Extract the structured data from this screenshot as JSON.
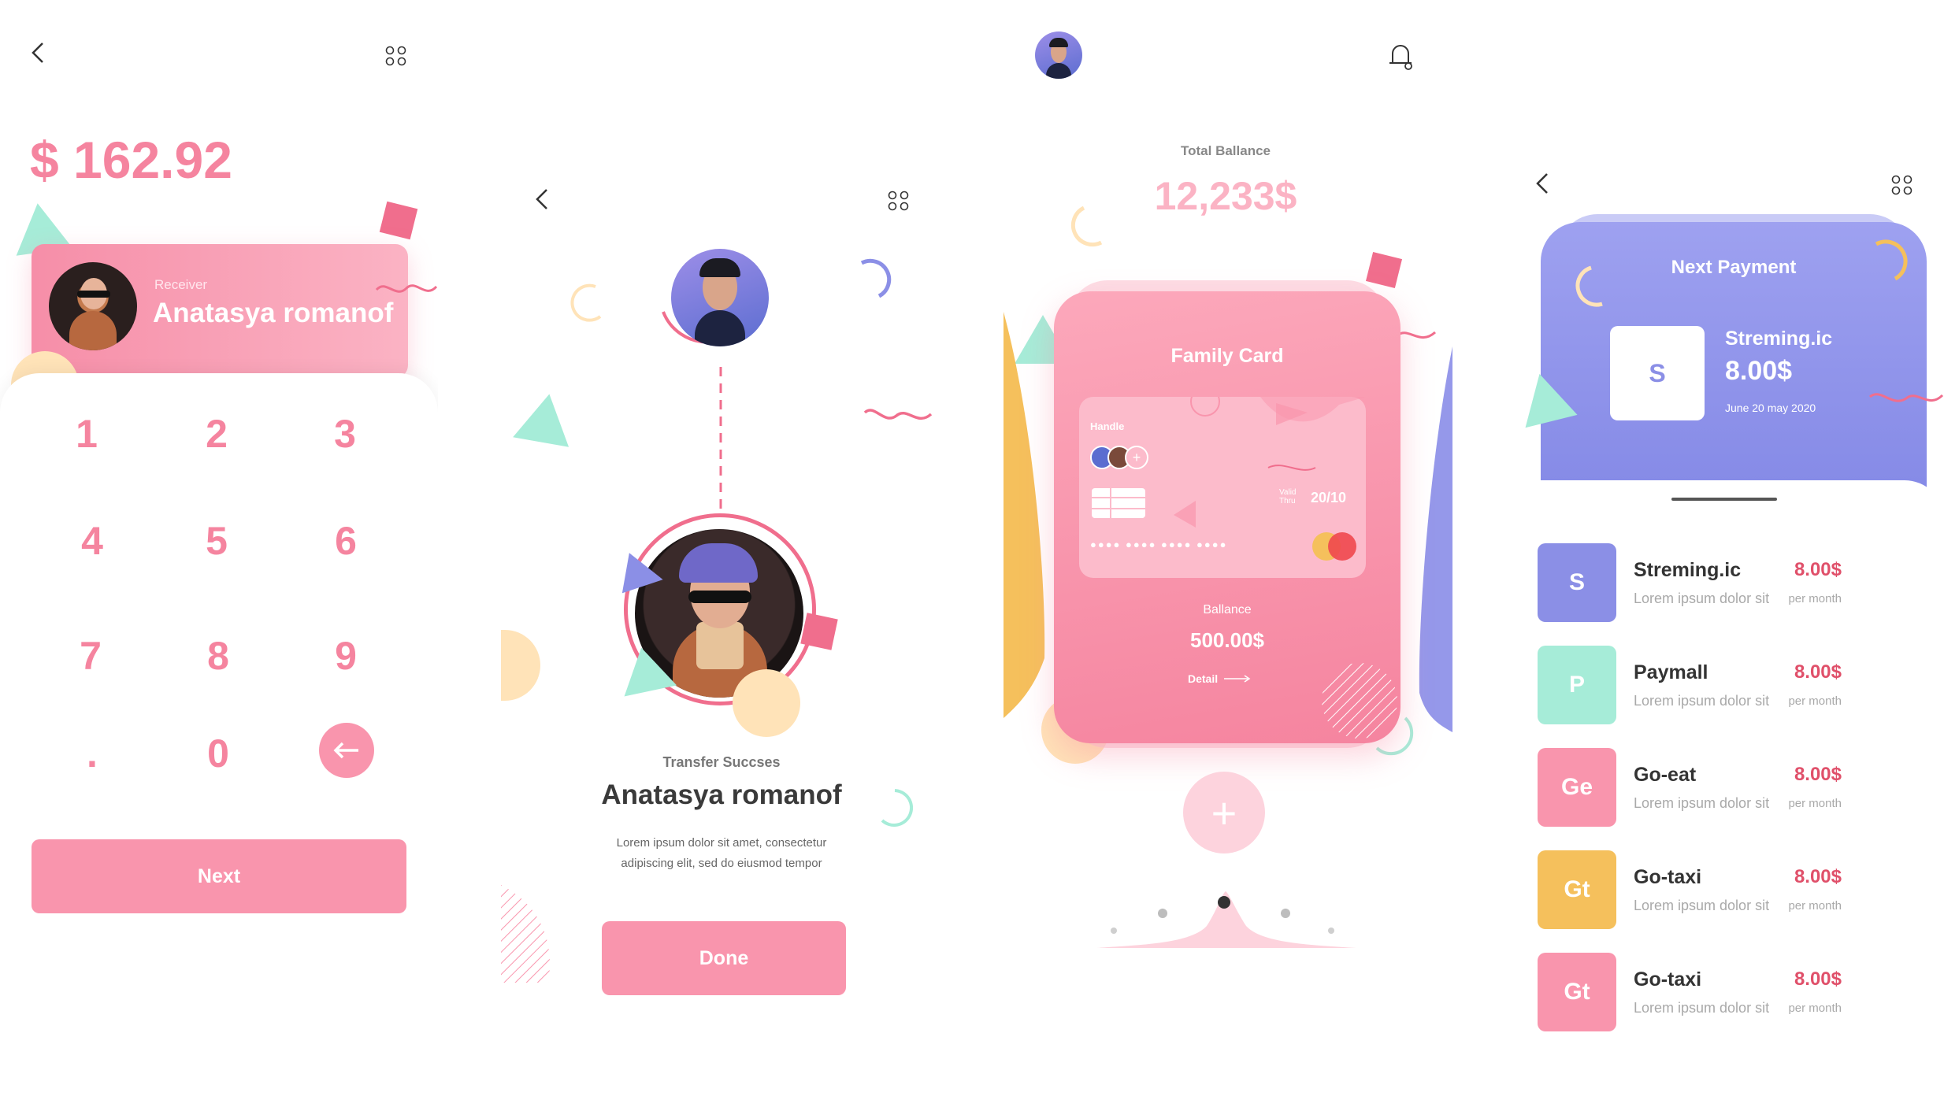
{
  "colors": {
    "pink": "#f995ad",
    "pink_dark": "#f06e8d",
    "mint": "#a6ecd8",
    "peach": "#ffe3b8",
    "purple": "#8b8fe6",
    "yellow": "#f5c05c",
    "red": "#e0506a"
  },
  "keypad_screen": {
    "amount": "$ 162.92",
    "receiver_caption": "Receiver",
    "receiver_name": "Anatasya romanof",
    "keys": [
      "1",
      "2",
      "3",
      "4",
      "5",
      "6",
      "7",
      "8",
      "9",
      ".",
      "0"
    ],
    "next_label": "Next",
    "icons": [
      "back-chevron-icon",
      "grid-dots-icon",
      "backspace-arrow-icon"
    ]
  },
  "success_screen": {
    "status_title": "Transfer Succses",
    "recipient_name": "Anatasya romanof",
    "description_line1": "Lorem ipsum dolor sit amet, consectetur",
    "description_line2": "adipiscing elit, sed do eiusmod tempor",
    "done_label": "Done"
  },
  "card_screen": {
    "total_label": "Total Ballance",
    "total_value": "12,233$",
    "card_title": "Family Card",
    "handle_label": "Handle",
    "valid_label": "Valid Thru",
    "valid_value": "20/10",
    "card_number_mask": "●●●● ●●●● ●●●● ●●●●",
    "balance_label": "Ballance",
    "balance_value": "500.00$",
    "detail_label": "Detail",
    "add_symbol": "+"
  },
  "payments_screen": {
    "next_payment_title": "Next Payment",
    "next_payment": {
      "tile_letter": "S",
      "name": "Streming.ic",
      "amount": "8.00$",
      "date": "June 20 may 2020"
    },
    "items": [
      {
        "letter": "S",
        "name": "Streming.ic",
        "subtitle": "Lorem ipsum dolor sit",
        "amount": "8.00$",
        "period": "per month",
        "color": "#8b8fe6"
      },
      {
        "letter": "P",
        "name": "Paymall",
        "subtitle": "Lorem ipsum dolor sit",
        "amount": "8.00$",
        "period": "per month",
        "color": "#a6ecd8"
      },
      {
        "letter": "Ge",
        "name": "Go-eat",
        "subtitle": "Lorem ipsum dolor sit",
        "amount": "8.00$",
        "period": "per month",
        "color": "#f995ad"
      },
      {
        "letter": "Gt",
        "name": "Go-taxi",
        "subtitle": "Lorem ipsum dolor sit",
        "amount": "8.00$",
        "period": "per month",
        "color": "#f5c05c"
      },
      {
        "letter": "Gt",
        "name": "Go-taxi",
        "subtitle": "Lorem ipsum dolor sit",
        "amount": "8.00$",
        "period": "per month",
        "color": "#f995ad"
      }
    ]
  }
}
